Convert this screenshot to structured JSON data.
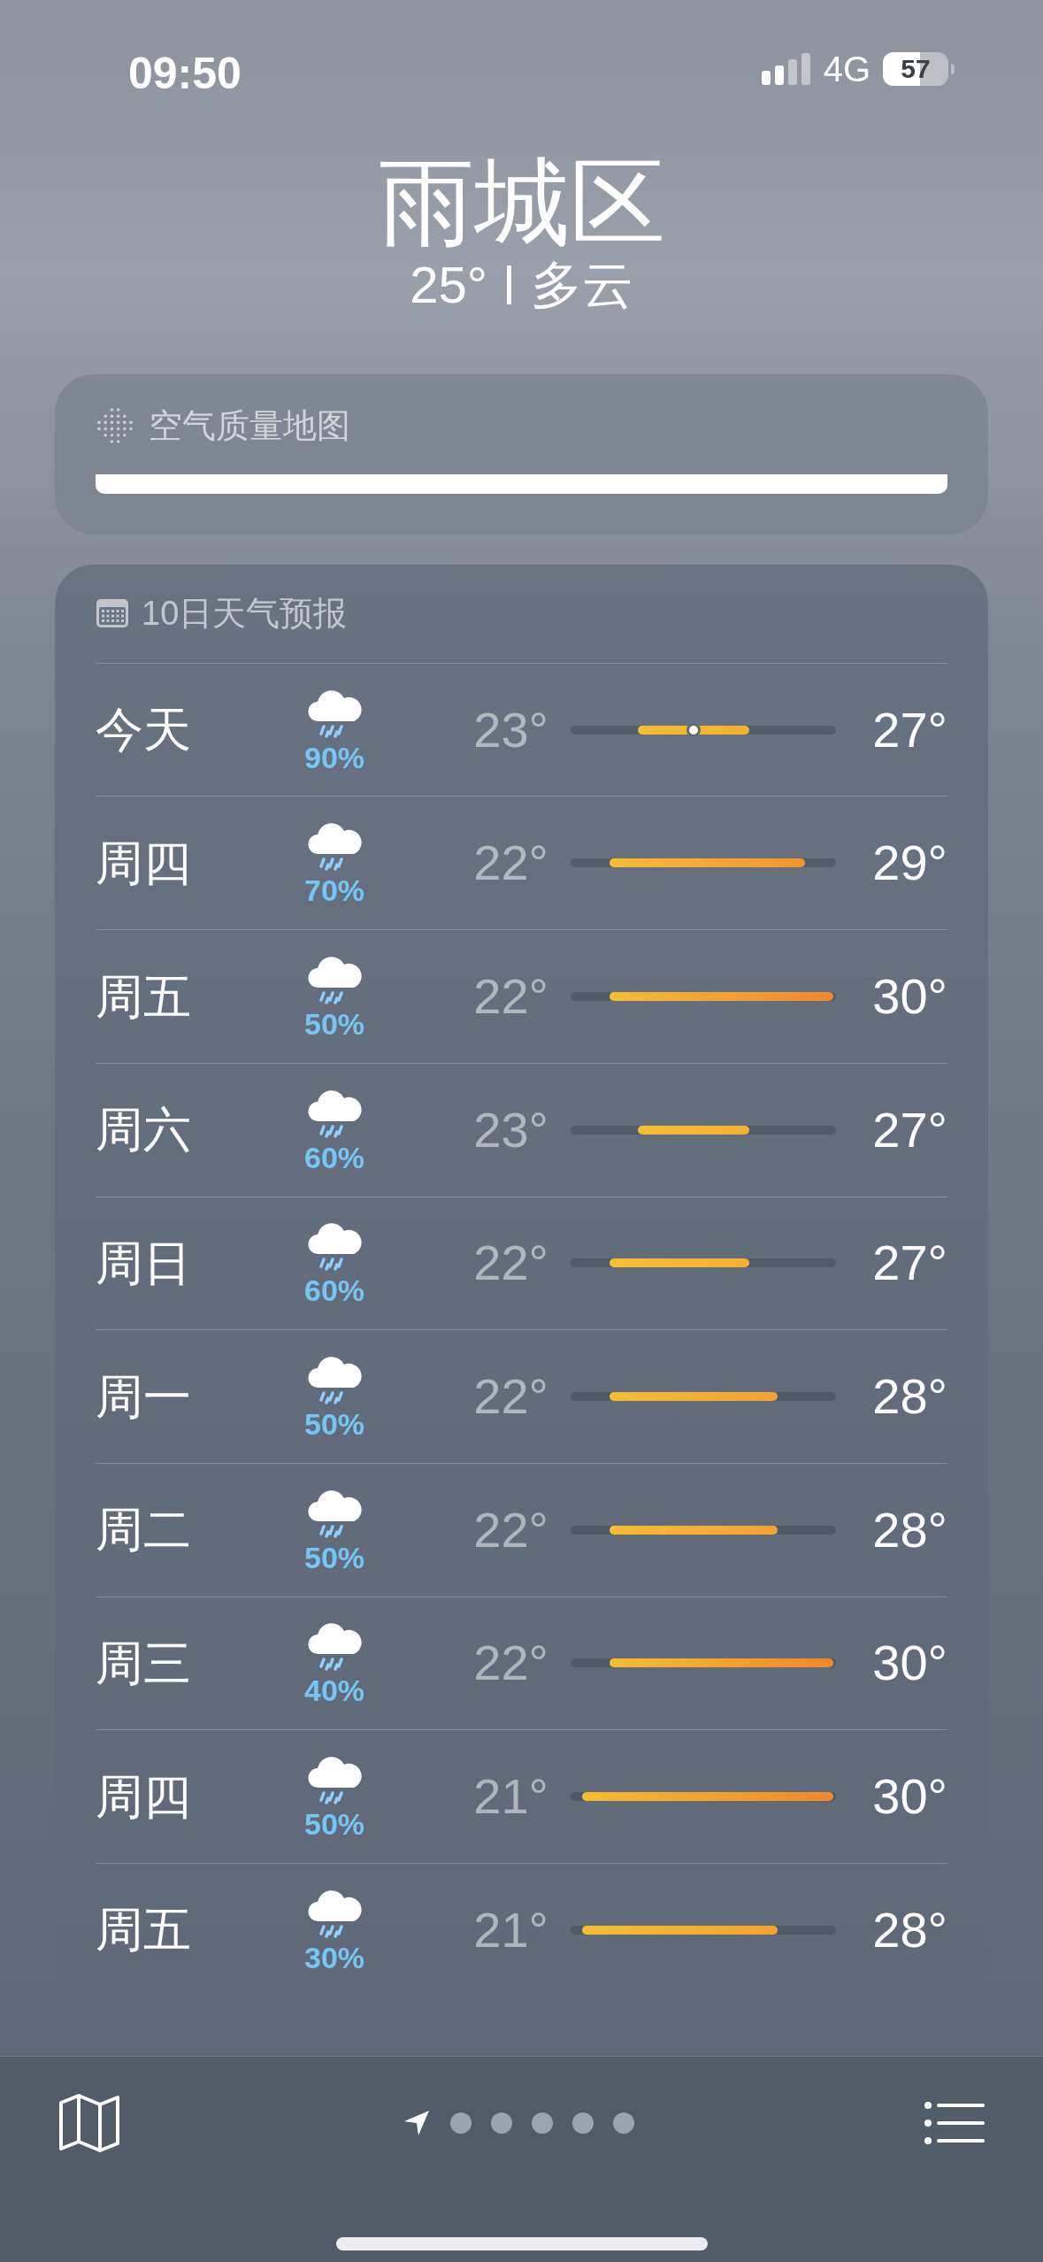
{
  "status_bar": {
    "time": "09:50",
    "network": "4G",
    "battery": {
      "text": "57",
      "level": 0.57
    }
  },
  "location": {
    "name": "雨城区",
    "temperature": "25°",
    "condition": "多云"
  },
  "air_quality": {
    "title": "空气质量地图"
  },
  "forecast": {
    "title": "10日天气预报",
    "days": [
      {
        "day": "今天",
        "precip": "90%",
        "low": "23°",
        "high": "27°",
        "current": true
      },
      {
        "day": "周四",
        "precip": "70%",
        "low": "22°",
        "high": "29°",
        "current": false
      },
      {
        "day": "周五",
        "precip": "50%",
        "low": "22°",
        "high": "30°",
        "current": false
      },
      {
        "day": "周六",
        "precip": "60%",
        "low": "23°",
        "high": "27°",
        "current": false
      },
      {
        "day": "周日",
        "precip": "60%",
        "low": "22°",
        "high": "27°",
        "current": false
      },
      {
        "day": "周一",
        "precip": "50%",
        "low": "22°",
        "high": "28°",
        "current": false
      },
      {
        "day": "周二",
        "precip": "50%",
        "low": "22°",
        "high": "28°",
        "current": false
      },
      {
        "day": "周三",
        "precip": "40%",
        "low": "22°",
        "high": "30°",
        "current": false
      },
      {
        "day": "周四",
        "precip": "50%",
        "low": "21°",
        "high": "30°",
        "current": false
      },
      {
        "day": "周五",
        "precip": "30%",
        "low": "21°",
        "high": "28°",
        "current": false
      }
    ]
  },
  "pages": [
    {
      "kind": "location",
      "selected": true
    },
    {
      "kind": "dot",
      "selected": false
    },
    {
      "kind": "dot",
      "selected": false
    },
    {
      "kind": "dot",
      "selected": false
    },
    {
      "kind": "dot",
      "selected": false
    },
    {
      "kind": "dot",
      "selected": false
    }
  ]
}
